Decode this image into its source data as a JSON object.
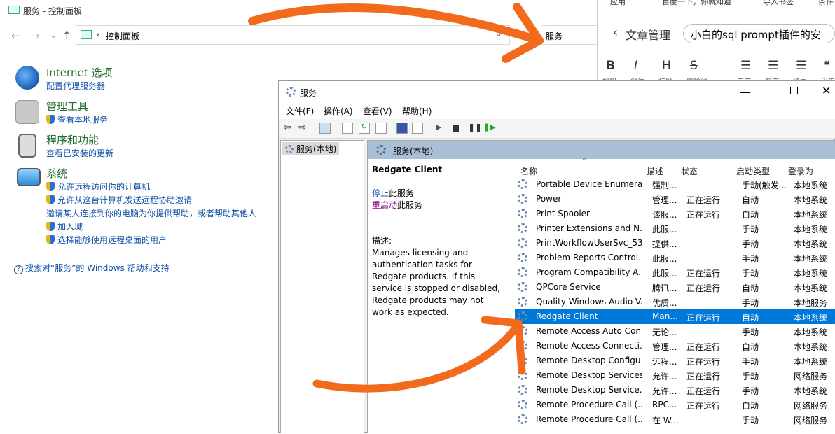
{
  "control_panel": {
    "window_title": "服务 - 控制面板",
    "address": "控制面板",
    "search_value": "服务",
    "items": [
      {
        "title": "Internet 选项",
        "links": [
          "配置代理服务器"
        ]
      },
      {
        "title": "管理工具",
        "links": [
          "查看本地服务"
        ]
      },
      {
        "title": "程序和功能",
        "links": [
          "查看已安装的更新"
        ]
      },
      {
        "title": "系统",
        "links": [
          "允许远程访问你的计算机",
          "允许从这台计算机发送远程协助邀请",
          "邀请某人连接到你的电脑为你提供帮助，或者帮助其他人",
          "加入域",
          "选择能够使用远程桌面的用户"
        ]
      }
    ],
    "help_link": "搜索对“服务”的 Windows 帮助和支持"
  },
  "browser": {
    "bookmarks": [
      "应用",
      "百度一下，你就知道",
      "导入书签",
      "条件"
    ],
    "back_label": "文章管理",
    "article_title": "小白的sql prompt插件的安",
    "format_buttons": [
      {
        "icon": "B",
        "label": "加粗"
      },
      {
        "icon": "I",
        "label": "斜体"
      },
      {
        "icon": "H",
        "label": "标题"
      },
      {
        "icon": "S",
        "label": "删除线"
      },
      {
        "icon": "☰",
        "label": "无序"
      },
      {
        "icon": "☰",
        "label": "有序"
      },
      {
        "icon": "☰",
        "label": "待办"
      },
      {
        "icon": "❝",
        "label": "引用"
      }
    ]
  },
  "services": {
    "window_title": "服务",
    "menu": [
      "文件(F)",
      "操作(A)",
      "查看(V)",
      "帮助(H)"
    ],
    "tree_item": "服务(本地)",
    "pane_header": "服务(本地)",
    "selected_name": "Redgate Client",
    "stop_link": "停止",
    "stop_rest": "此服务",
    "restart_link": "重启动",
    "restart_rest": "此服务",
    "desc_label": "描述:",
    "description": "Manages licensing and authentication tasks for Redgate products. If this service is stopped or disabled, Redgate products may not work as expected.",
    "columns": [
      "名称",
      "描述",
      "状态",
      "启动类型",
      "登录为"
    ],
    "rows": [
      {
        "name": "Portable Device Enumera...",
        "desc": "强制...",
        "status": "",
        "start": "手动(触发...",
        "logon": "本地系统"
      },
      {
        "name": "Power",
        "desc": "管理...",
        "status": "正在运行",
        "start": "自动",
        "logon": "本地系统"
      },
      {
        "name": "Print Spooler",
        "desc": "该服...",
        "status": "正在运行",
        "start": "自动",
        "logon": "本地系统"
      },
      {
        "name": "Printer Extensions and N...",
        "desc": "此服...",
        "status": "",
        "start": "手动",
        "logon": "本地系统"
      },
      {
        "name": "PrintWorkflowUserSvc_53...",
        "desc": "提供...",
        "status": "",
        "start": "手动",
        "logon": "本地系统"
      },
      {
        "name": "Problem Reports Control...",
        "desc": "此服...",
        "status": "",
        "start": "手动",
        "logon": "本地系统"
      },
      {
        "name": "Program Compatibility A...",
        "desc": "此服...",
        "status": "正在运行",
        "start": "手动",
        "logon": "本地系统"
      },
      {
        "name": "QPCore Service",
        "desc": "腾讯...",
        "status": "正在运行",
        "start": "自动",
        "logon": "本地系统"
      },
      {
        "name": "Quality Windows Audio V...",
        "desc": "优质...",
        "status": "",
        "start": "手动",
        "logon": "本地服务"
      },
      {
        "name": "Redgate Client",
        "desc": "Man...",
        "status": "正在运行",
        "start": "自动",
        "logon": "本地系统",
        "selected": true
      },
      {
        "name": "Remote Access Auto Con...",
        "desc": "无论...",
        "status": "",
        "start": "手动",
        "logon": "本地系统"
      },
      {
        "name": "Remote Access Connecti...",
        "desc": "管理...",
        "status": "正在运行",
        "start": "自动",
        "logon": "本地系统"
      },
      {
        "name": "Remote Desktop Configu...",
        "desc": "远程...",
        "status": "正在运行",
        "start": "手动",
        "logon": "本地系统"
      },
      {
        "name": "Remote Desktop Services",
        "desc": "允许...",
        "status": "正在运行",
        "start": "手动",
        "logon": "网络服务"
      },
      {
        "name": "Remote Desktop Service...",
        "desc": "允许...",
        "status": "正在运行",
        "start": "手动",
        "logon": "本地系统"
      },
      {
        "name": "Remote Procedure Call (...",
        "desc": "RPC...",
        "status": "正在运行",
        "start": "自动",
        "logon": "网络服务"
      },
      {
        "name": "Remote Procedure Call (...",
        "desc": "在 W...",
        "status": "",
        "start": "手动",
        "logon": "网络服务"
      }
    ]
  },
  "colors": {
    "accent_arrow": "#f26a1b",
    "selection": "#0078d7",
    "cp_heading": "#1e6b2d",
    "link": "#0e4fa8"
  }
}
